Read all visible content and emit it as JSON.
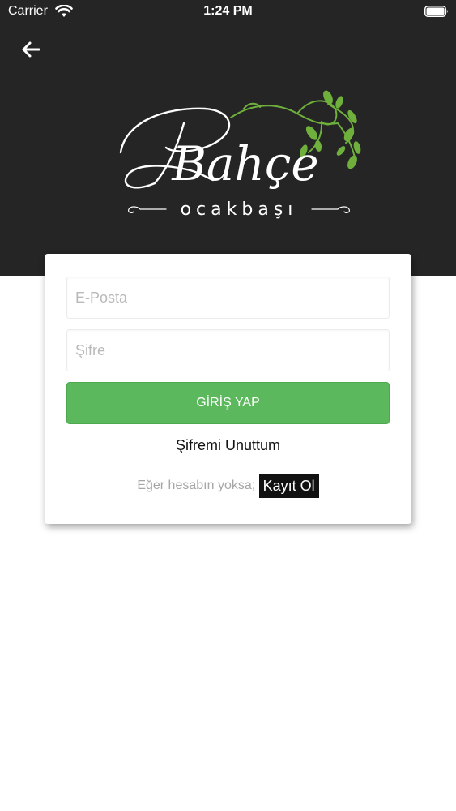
{
  "status_bar": {
    "carrier": "Carrier",
    "time": "1:24 PM",
    "icons": [
      "wifi-icon",
      "battery-icon"
    ]
  },
  "header": {
    "back_icon": "arrow-left-icon",
    "logo": {
      "title": "Bahçe",
      "subtitle": "ocakbaşı"
    }
  },
  "login_form": {
    "email_placeholder": "E-Posta",
    "email_value": "",
    "password_placeholder": "Şifre",
    "password_value": "",
    "login_button_label": "GİRİŞ YAP",
    "forgot_password_label": "Şifremi Unuttum",
    "register_prompt": "Eğer hesabın yoksa;",
    "register_label": "Kayıt Ol"
  },
  "colors": {
    "header_background": "#252525",
    "login_button": "#5cb85c",
    "register_background": "#111111",
    "leaf_green": "#6fb03c"
  }
}
